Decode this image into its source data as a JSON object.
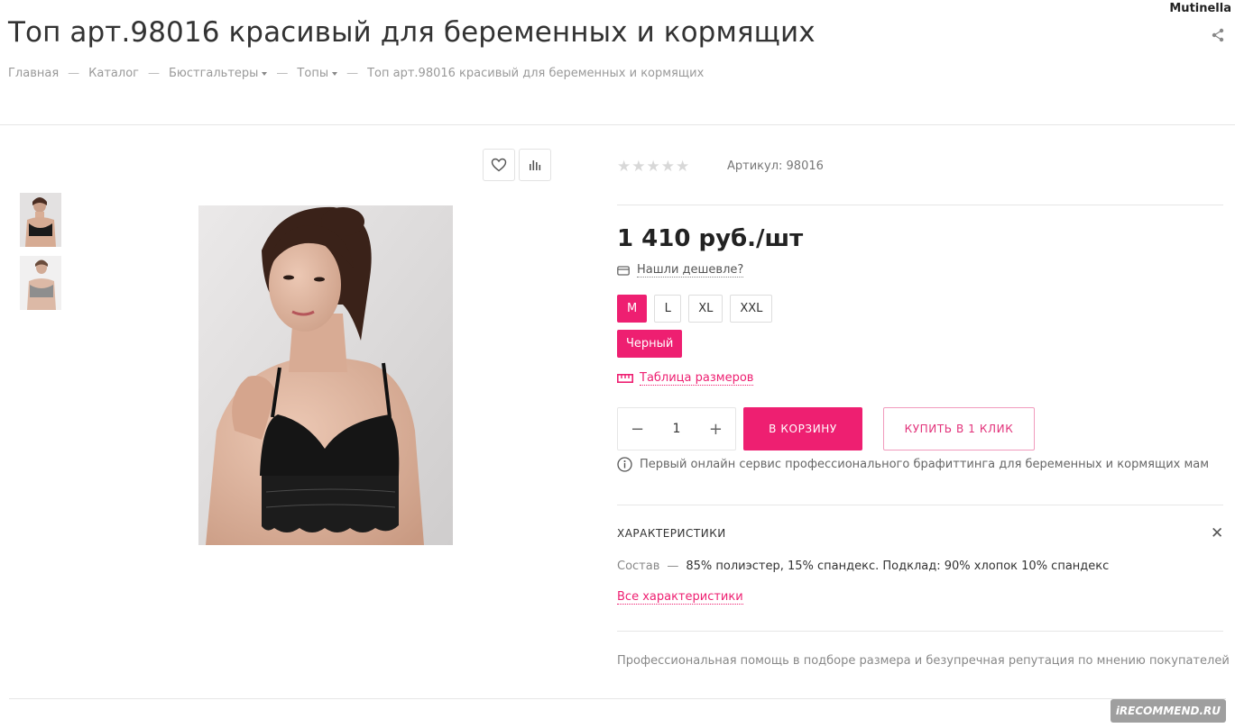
{
  "header": {
    "username": "Mutinella",
    "title": "Топ арт.98016 красивый для беременных и кормящих"
  },
  "breadcrumb": [
    {
      "label": "Главная",
      "dropdown": false
    },
    {
      "label": "Каталог",
      "dropdown": false
    },
    {
      "label": "Бюстгальтеры",
      "dropdown": true
    },
    {
      "label": "Топы",
      "dropdown": true
    },
    {
      "label": "Топ арт.98016 красивый для беременных и кормящих",
      "dropdown": false
    }
  ],
  "breadcrumb_separator": "—",
  "product": {
    "rating_stars": "★★★★★",
    "rating_value": 0,
    "sku_label": "Артикул: 98016",
    "price": "1 410 руб./шт",
    "cheaper_label": "Нашли дешевле?",
    "sizes": [
      "M",
      "L",
      "XL",
      "XXL"
    ],
    "selected_size": "M",
    "color": "Черный",
    "size_table_label": "Таблица размеров",
    "quantity": "1",
    "cart_button": "В КОРЗИНУ",
    "oneclick_button": "КУПИТЬ В 1 КЛИК",
    "info_text": "Первый онлайн сервис профессионального брафиттинга для беременных и кормящих мам"
  },
  "characteristics": {
    "title": "ХАРАКТЕРИСТИКИ",
    "composition_key": "Состав",
    "composition_sep": "—",
    "composition_value": "85% полиэстер, 15% спандекс. Подклад: 90% хлопок 10% спандекс",
    "all_link": "Все характеристики"
  },
  "help_text": "Профессиональная помощь в подборе размера и безупречная репутация по мнению покупателей",
  "watermark": "iRECOMMEND.RU",
  "colors": {
    "accent": "#ee1f71",
    "text": "#333333",
    "muted": "#999999"
  },
  "icons": [
    "share-icon",
    "heart-icon",
    "compare-chart-icon",
    "wallet-icon",
    "ruler-icon",
    "info-icon",
    "close-icon"
  ]
}
